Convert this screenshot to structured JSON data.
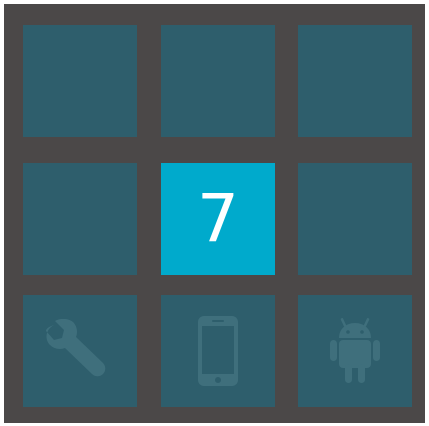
{
  "grid": {
    "tiles": [
      {
        "label": ""
      },
      {
        "label": ""
      },
      {
        "label": ""
      },
      {
        "label": ""
      },
      {
        "label": "7"
      },
      {
        "label": ""
      },
      {
        "label": "",
        "icon": "wrench-icon"
      },
      {
        "label": "",
        "icon": "phone-icon"
      },
      {
        "label": "",
        "icon": "android-icon"
      }
    ]
  },
  "colors": {
    "background": "#4b4848",
    "tile": "#2e5e6c",
    "active_tile": "#00aacc",
    "icon": "#3f6f7c"
  }
}
